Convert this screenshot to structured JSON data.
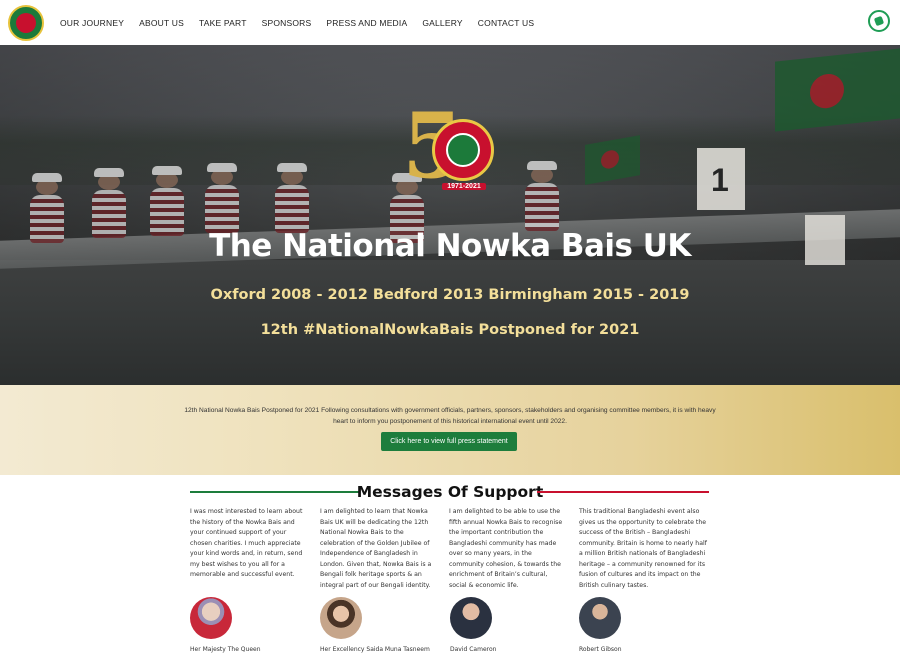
{
  "nav": {
    "items": [
      "OUR JOURNEY",
      "ABOUT US",
      "TAKE PART",
      "SPONSORS",
      "PRESS AND MEDIA",
      "GALLERY",
      "CONTACT US"
    ]
  },
  "hero": {
    "title": "The National Nowka Bais UK",
    "subtitle1": "Oxford 2008 - 2012 Bedford 2013 Birmingham 2015 - 2019",
    "subtitle2": "12th #NationalNowkaBais Postponed for 2021",
    "emblem_years": "1971-2021",
    "board_number": "1"
  },
  "notice": {
    "text": "12th National Nowka Bais Postponed for 2021 Following consultations with government officials, partners, sponsors, stakeholders and organising committee members, it is with heavy heart to inform you postponement of this historical international event until 2022.",
    "button_label": "Click here to view full press statement"
  },
  "messages": {
    "title": "Messages Of Support",
    "items": [
      {
        "text": "I was most interested to learn about the history of the Nowka Bais and your continued support of your chosen charities. I much appreciate your kind words and, in return, send my best wishes to you all for a memorable and successful event.",
        "caption": "Her Majesty The Queen"
      },
      {
        "text": "I am delighted to learn that Nowka Bais UK will be dedicating the 12th National Nowka Bais to the celebration of the Golden Jubilee of Independence of Bangladesh in London. Given that, Nowka Bais is a Bengali folk heritage sports & an integral part of our Bengali identity.",
        "caption": "Her Excellency Saida Muna Tasneem"
      },
      {
        "text": "I am delighted to be able to use the fifth annual Nowka Bais to recognise the important contribution the Bangladeshi community has made over so many years, in the community cohesion, & towards the enrichment of Britain’s cultural, social & economic life.",
        "caption": "David Cameron"
      },
      {
        "text": "This traditional Bangladeshi event also gives us the opportunity to celebrate the success of the British – Bangladeshi community. Britain is home to nearly half a million British nationals of Bangladeshi heritage – a community renowned for its fusion of cultures and its impact on the British culinary tastes.",
        "caption": "Robert Gibson"
      }
    ]
  },
  "colors": {
    "accent_green": "#1d7d3c",
    "accent_red": "#c8102e",
    "gold": "#d8b24a"
  }
}
